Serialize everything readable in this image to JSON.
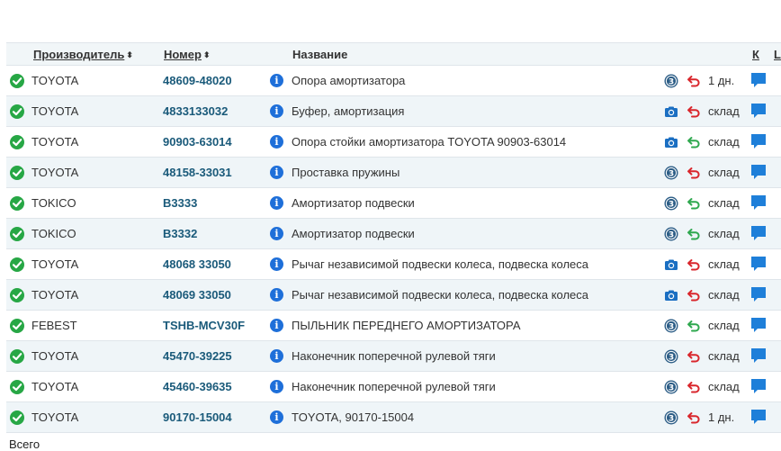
{
  "header": {
    "manufacturer": "Производитель",
    "number": "Номер",
    "name": "Название",
    "k": "К",
    "l": "L",
    "sort_glyph": "⬍"
  },
  "rows": [
    {
      "brand": "TOYOTA",
      "number": "48609-48020",
      "name": "Опора амортизатора",
      "source": "badge",
      "return": "red",
      "stock": "1 дн."
    },
    {
      "brand": "TOYOTA",
      "number": "4833133032",
      "name": "Буфер, амортизация",
      "source": "camera",
      "return": "red",
      "stock": "склад"
    },
    {
      "brand": "TOYOTA",
      "number": "90903-63014",
      "name": "Опора стойки амортизатора TOYOTA 90903-63014",
      "source": "camera",
      "return": "green",
      "stock": "склад"
    },
    {
      "brand": "TOYOTA",
      "number": "48158-33031",
      "name": "Проставка пружины",
      "source": "badge",
      "return": "red",
      "stock": "склад"
    },
    {
      "brand": "TOKICO",
      "number": "B3333",
      "name": "Амортизатор подвески",
      "source": "badge",
      "return": "green",
      "stock": "склад"
    },
    {
      "brand": "TOKICO",
      "number": "B3332",
      "name": "Амортизатор подвески",
      "source": "badge",
      "return": "green",
      "stock": "склад"
    },
    {
      "brand": "TOYOTA",
      "number": "48068 33050",
      "name": "Рычаг независимой подвески колеса, подвеска колеса",
      "source": "camera",
      "return": "red",
      "stock": "склад"
    },
    {
      "brand": "TOYOTA",
      "number": "48069 33050",
      "name": "Рычаг независимой подвески колеса, подвеска колеса",
      "source": "camera",
      "return": "red",
      "stock": "склад"
    },
    {
      "brand": "FEBEST",
      "number": "TSHB-MCV30F",
      "name": "ПЫЛЬНИК ПЕРЕДНЕГО АМОРТИЗАТОРА",
      "source": "badge",
      "return": "green",
      "stock": "склад"
    },
    {
      "brand": "TOYOTA",
      "number": "45470-39225",
      "name": "Наконечник поперечной рулевой тяги",
      "source": "badge",
      "return": "red",
      "stock": "склад"
    },
    {
      "brand": "TOYOTA",
      "number": "45460-39635",
      "name": "Наконечник поперечной рулевой тяги",
      "source": "badge",
      "return": "red",
      "stock": "склад"
    },
    {
      "brand": "TOYOTA",
      "number": "90170-15004",
      "name": "TOYOTA, 90170-15004",
      "source": "badge",
      "return": "red",
      "stock": "1 дн."
    }
  ],
  "footer": {
    "total_label": "Всего"
  },
  "colors": {
    "check": "#27a745",
    "info": "#1e6fd9",
    "return_red": "#d9262c",
    "return_green": "#2fa84f",
    "message": "#1e7fd9",
    "camera": "#1b6fc2",
    "badge": "#2c5d86",
    "part_number": "#1a5a7a",
    "alt_row": "#eff5f8"
  },
  "icons": {
    "status": "check-circle-icon",
    "info": "info-icon",
    "camera": "camera-icon",
    "badge": "source-badge-icon",
    "return": "return-arrow-icon",
    "message": "message-bubble-icon"
  }
}
